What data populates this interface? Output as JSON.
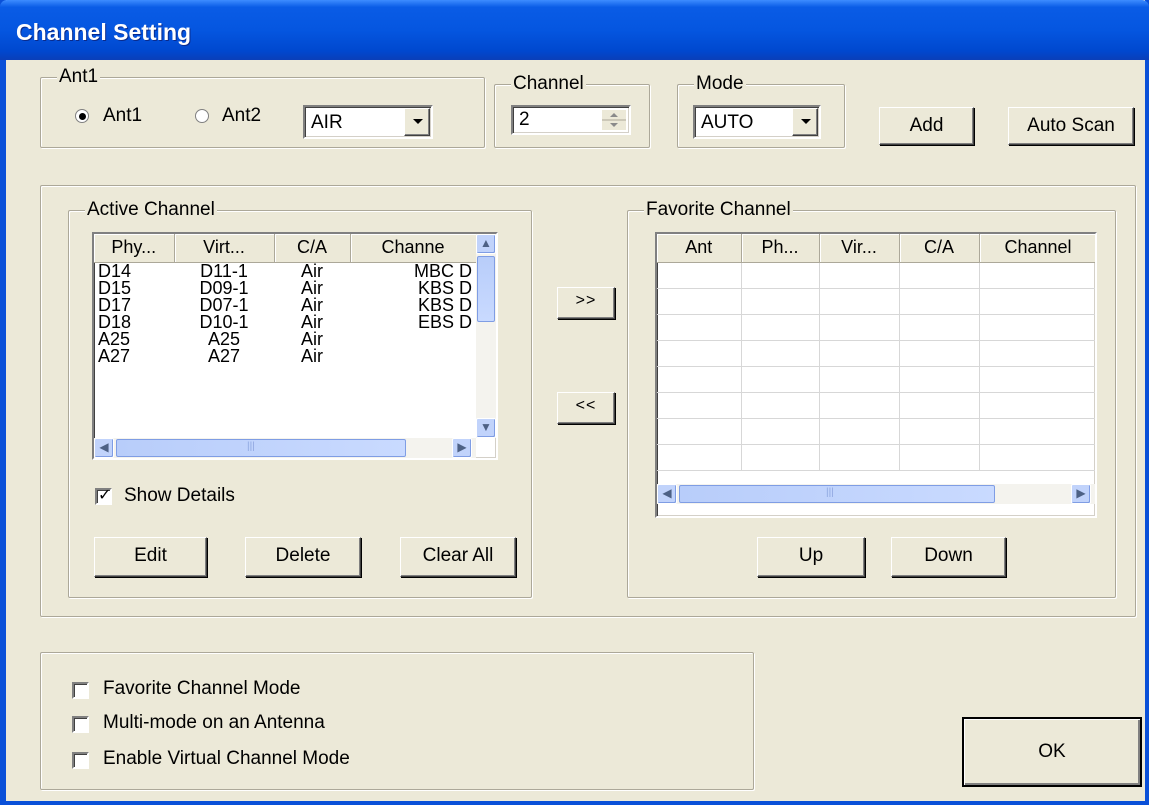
{
  "window": {
    "title": "Channel Setting"
  },
  "antenna_group": {
    "legend": "Ant1",
    "radio_ant1": "Ant1",
    "radio_ant2": "Ant2",
    "source_value": "AIR"
  },
  "channel_group": {
    "legend": "Channel",
    "value": "2"
  },
  "mode_group": {
    "legend": "Mode",
    "value": "AUTO"
  },
  "buttons": {
    "add": "Add",
    "auto_scan": "Auto Scan",
    "move_right": ">>",
    "move_left": "<<",
    "edit": "Edit",
    "delete": "Delete",
    "clear_all": "Clear All",
    "up": "Up",
    "down": "Down",
    "ok": "OK"
  },
  "active_channel": {
    "legend": "Active Channel",
    "columns": [
      "Phy...",
      "Virt...",
      "C/A",
      "Channe"
    ],
    "rows": [
      [
        "D14",
        "D11-1",
        "Air",
        "MBC D"
      ],
      [
        "D15",
        "D09-1",
        "Air",
        "KBS D"
      ],
      [
        "D17",
        "D07-1",
        "Air",
        "KBS D"
      ],
      [
        "D18",
        "D10-1",
        "Air",
        "EBS D"
      ],
      [
        "A25",
        "A25",
        "Air",
        ""
      ],
      [
        "A27",
        "A27",
        "Air",
        ""
      ]
    ],
    "show_details_label": "Show Details",
    "show_details_checked": true
  },
  "favorite_channel": {
    "legend": "Favorite Channel",
    "columns": [
      "Ant",
      "Ph...",
      "Vir...",
      "C/A",
      "Channel"
    ]
  },
  "options": {
    "favorite_mode": "Favorite Channel Mode",
    "multi_mode": "Multi-mode on an Antenna",
    "virtual_mode": "Enable Virtual Channel Mode"
  },
  "colors": {
    "titlebar": "#0556e0",
    "dialog_bg": "#ece9d8"
  }
}
